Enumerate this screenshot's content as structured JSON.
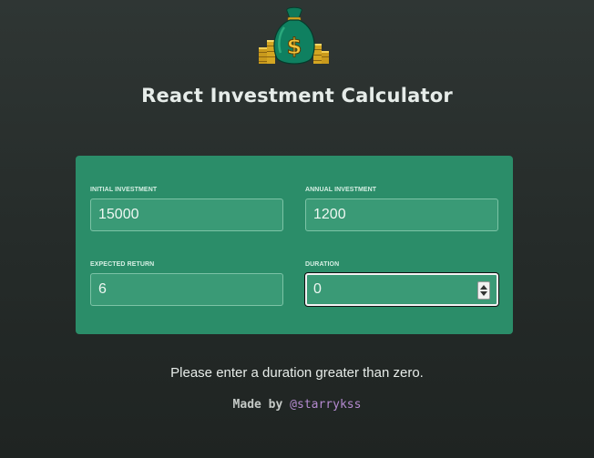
{
  "header": {
    "logo_icon": "money-bag-dollar-icon",
    "title": "React Investment Calculator"
  },
  "form": {
    "fields": [
      {
        "label": "INITIAL INVESTMENT",
        "value": "15000"
      },
      {
        "label": "ANNUAL INVESTMENT",
        "value": "1200"
      },
      {
        "label": "EXPECTED RETURN",
        "value": "6"
      },
      {
        "label": "DURATION",
        "value": "0",
        "focused": true
      }
    ]
  },
  "message": "Please enter a duration greater than zero.",
  "footer": {
    "prefix": "Made by ",
    "handle": "@starrykss"
  },
  "colors": {
    "background": "#2a302e",
    "panel": "#2b8d69",
    "input_bg": "#3a9a76",
    "handle": "#b48ad0"
  }
}
